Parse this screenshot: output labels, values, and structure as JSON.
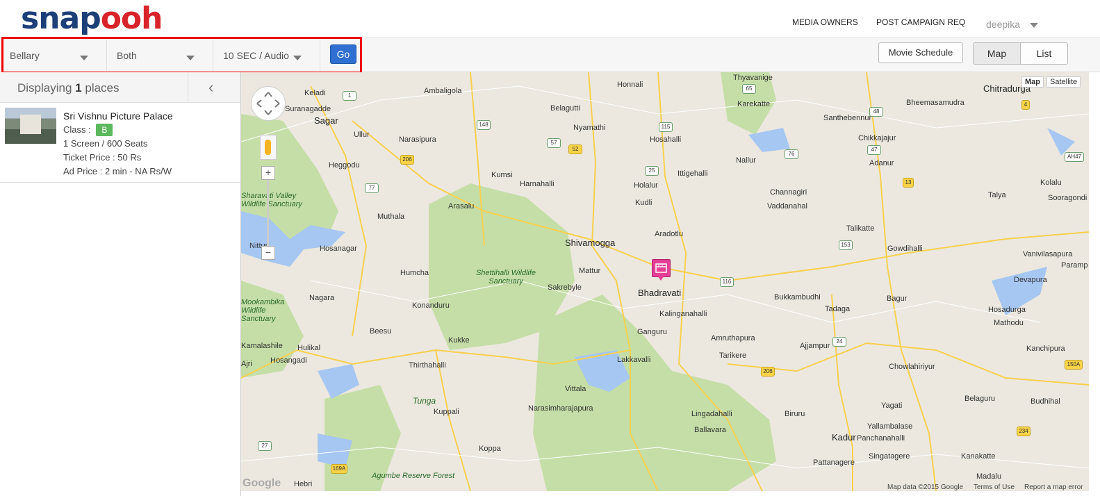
{
  "header": {
    "logo_part1": "snap",
    "logo_part2": "ooh",
    "nav": [
      "MEDIA OWNERS",
      "POST CAMPAIGN REQ"
    ],
    "user": "deepika"
  },
  "toolbar": {
    "city": "Bellary",
    "type": "Both",
    "ad_format": "10 SEC / Audio",
    "go": "Go",
    "movie_schedule": "Movie Schedule",
    "view_map": "Map",
    "view_list": "List"
  },
  "sidebar": {
    "displaying_prefix": "Displaying",
    "count": "1",
    "displaying_suffix": "places",
    "items": [
      {
        "name": "Sri Vishnu Picture Palace",
        "class_label": "Class :",
        "class_value": "B",
        "screens": "1 Screen / 600 Seats",
        "ticket": "Ticket Price : 50 Rs",
        "ad_price": "Ad Price : 2 min - NA Rs/W"
      }
    ]
  },
  "map": {
    "type_map": "Map",
    "type_satellite": "Satellite",
    "footer_data": "Map data ©2015 Google",
    "footer_terms": "Terms of Use",
    "footer_report": "Report a map error",
    "google": "Google",
    "cities": [
      "Shivamogga",
      "Bhadravati",
      "Sagar",
      "Chitradurga",
      "Kadur"
    ],
    "places": [
      "Honnali",
      "Thyavanige",
      "Keladi",
      "Ambaligola",
      "Belagutti",
      "Karekatte",
      "Bheemasamudra",
      "Suranagadde",
      "Nyamathi",
      "Santhebennur",
      "Ullur",
      "Hosahalli",
      "Chikkajajur",
      "Narasipura",
      "Heggodu",
      "Nallur",
      "Adanur",
      "Ittigehalli",
      "Kumsi",
      "Harnahalli",
      "Holalur",
      "Kolalu",
      "Talya",
      "Sooragondi",
      "Channagiri",
      "Arasalu",
      "Vaddanahal",
      "Kudli",
      "Muthala",
      "Aradotlu",
      "Talikatte",
      "Hosanagar",
      "Gowdihalli",
      "Nittur",
      "Vanivilasapura",
      "Mattur",
      "Paramp",
      "Humcha",
      "Sakrebyle",
      "Devapura",
      "Bukkambudhi",
      "Nagara",
      "Bagur",
      "Konanduru",
      "Tadaga",
      "Hosadurga",
      "Kalinganahalli",
      "Mathodu",
      "Beesu",
      "Ganguru",
      "Amruthapura",
      "Ajjampur",
      "Kanchipura",
      "Kamalashile",
      "Hulikal",
      "Kukke",
      "Tarikere",
      "Ajri",
      "Hosangadi",
      "Lakkavalli",
      "Chowlahiriyur",
      "Thirthahalli",
      "Vittala",
      "Belaguru",
      "Yagati",
      "Budhihal",
      "Kuppali",
      "Narasimharajapura",
      "Lingadahalli",
      "Biruru",
      "Yallambalase",
      "Panchanahalli",
      "Singatagere",
      "Kanakatte",
      "Koppa",
      "Ballavara",
      "Pattanagere",
      "Madalu",
      "Hebri",
      "Tunga"
    ],
    "parks": [
      "Shettihalli Wildlife Sanctuary",
      "Sharavati Valley Wildlife Sanctuary",
      "Mookambika Wildlife Sanctuary",
      "Agumbe Reserve Forest"
    ],
    "highways": [
      "65",
      "1",
      "148",
      "115",
      "48",
      "57",
      "52",
      "206",
      "25",
      "76",
      "47",
      "4",
      "AH47",
      "13",
      "77",
      "153",
      "116",
      "24",
      "150A",
      "27",
      "169A",
      "234",
      "206"
    ]
  }
}
